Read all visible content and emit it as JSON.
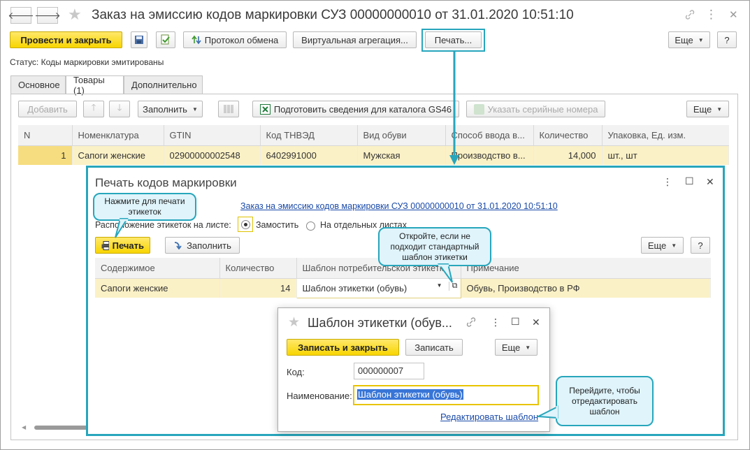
{
  "window": {
    "title": "Заказ на эмиссию кодов маркировки СУЗ 00000000010 от 31.01.2020 10:51:10",
    "back_glyph": "🡐",
    "forward_glyph": "🡒",
    "star_glyph": "★",
    "more_glyph": "⋮",
    "close_glyph": "✕"
  },
  "toolbar": {
    "post_close": "Провести и закрыть",
    "exchange_protocol": "Протокол обмена",
    "virtual_aggregation": "Виртуальная агрегация...",
    "print": "Печать...",
    "more": "Еще",
    "help": "?"
  },
  "status": "Статус: Коды маркировки эмитированы",
  "tabs": [
    {
      "label": "Основное"
    },
    {
      "label": "Товары (1)"
    },
    {
      "label": "Дополнительно"
    }
  ],
  "goods_toolbar": {
    "add": "Добавить",
    "fill": "Заполнить",
    "prepare_gs46": "Подготовить сведения для каталога GS46",
    "serial_numbers": "Указать серийные номера",
    "more": "Еще"
  },
  "goods_table": {
    "columns": [
      "N",
      "Номенклатура",
      "GTIN",
      "Код ТНВЭД",
      "Вид обуви",
      "Способ ввода в...",
      "Количество",
      "Упаковка, Ед. изм."
    ],
    "rows": [
      [
        "1",
        "Сапоги женские",
        "02900000002548",
        "6402991000",
        "Мужская",
        "Производство в...",
        "14,000",
        "шт., шт"
      ]
    ]
  },
  "print_dialog": {
    "title": "Печать кодов маркировки",
    "order_link": "Заказ на эмиссию кодов маркировки СУЗ 00000000010 от 31.01.2020 10:51:10",
    "layout_label": "Расположение этикеток на листе:",
    "option_tile": "Замостить",
    "option_separate": "На отдельных листах",
    "print_button": "Печать",
    "fill_button": "Заполнить",
    "more": "Еще",
    "help": "?",
    "columns": [
      "Содержимое",
      "Количество",
      "Шаблон потребительской этикетки",
      "Примечание"
    ],
    "rows": [
      [
        "Сапоги женские",
        "14",
        "Шаблон этикетки (обувь)",
        "Обувь, Производство в РФ"
      ]
    ]
  },
  "template_dialog": {
    "title": "Шаблон этикетки (обув...",
    "save_close": "Записать и закрыть",
    "save": "Записать",
    "more": "Еще",
    "code_label": "Код:",
    "code_value": "000000007",
    "name_label": "Наименование:",
    "name_value": "Шаблон этикетки (обувь)",
    "edit_link": "Редактировать шаблон"
  },
  "callouts": {
    "print_hint": "Нажмите для печати этикеток",
    "open_hint": "Откройте, если не подходит стандартный шаблон этикетки",
    "edit_hint": "Перейдите, чтобы отредактировать шаблон"
  },
  "colors": {
    "accent_yellow": "#f8d500",
    "callout_border": "#27a6bc",
    "callout_fill": "#dff4fb",
    "selection": "#fbf1c6",
    "link": "#1a4aa8"
  }
}
